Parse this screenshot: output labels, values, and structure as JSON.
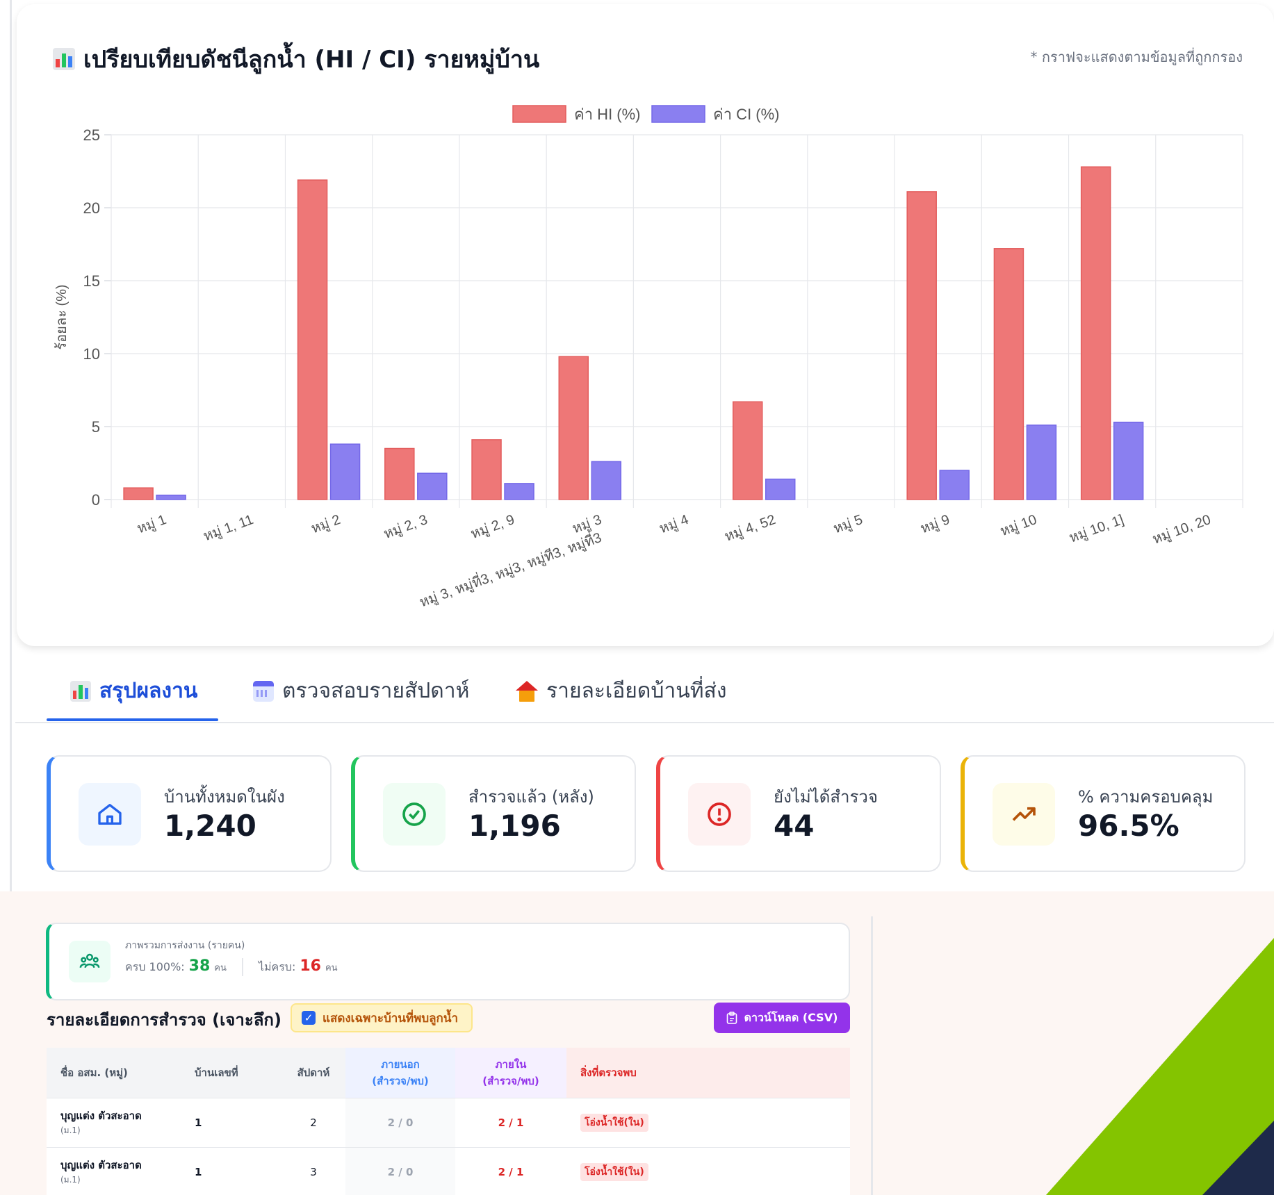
{
  "chart_card": {
    "title": "เปรียบเทียบดัชนีลูกน้ำ (HI / CI) รายหมู่บ้าน",
    "note": "* กราฟจะแสดงตามข้อมูลที่ถูกกรอง"
  },
  "chart_data": {
    "type": "bar",
    "categories": [
      "หมู่ 1",
      "หมู่ 1, 11",
      "หมู่ 2",
      "หมู่ 2, 3",
      "หมู่ 2, 9",
      [
        "หมู่ 3",
        "หมู่ 3, หมู่ที่3, หมู่3, หมู่ที3, หมู่ที่3"
      ],
      "หมู่ 4",
      "หมู่ 4, 52",
      "หมู่ 5",
      "หมู่ 9",
      "หมู่ 10",
      "หมู่ 10, 1]",
      "หมู่ 10, 20"
    ],
    "series": [
      {
        "name": "ค่า HI (%)",
        "color": "#ee7777",
        "values": [
          0.8,
          0,
          21.9,
          3.5,
          4.1,
          9.8,
          0,
          6.7,
          0,
          21.1,
          17.2,
          22.8,
          0,
          0
        ]
      },
      {
        "name": "ค่า CI (%)",
        "color": "#8a7ff0",
        "values": [
          0.3,
          0,
          3.8,
          1.8,
          1.1,
          2.6,
          0,
          1.4,
          0,
          2.0,
          5.1,
          5.3,
          0,
          0
        ]
      }
    ],
    "xlabel": "",
    "ylabel": "ร้อยละ (%)",
    "ylim": [
      0,
      25
    ],
    "yticks": [
      0,
      5,
      10,
      15,
      20,
      25
    ],
    "grid": true,
    "legend": "top-center"
  },
  "tabs": [
    {
      "label": "สรุปผลงาน",
      "active": true
    },
    {
      "label": "ตรวจสอบรายสัปดาห์",
      "active": false
    },
    {
      "label": "รายละเอียดบ้านที่ส่ง",
      "active": false
    }
  ],
  "stats": [
    {
      "label": "บ้านทั้งหมดในผัง",
      "value": "1,240",
      "color": "#3b82f6",
      "icon": "home-icon"
    },
    {
      "label": "สำรวจแล้ว (หลัง)",
      "value": "1,196",
      "color": "#22c55e",
      "icon": "check-circle-icon"
    },
    {
      "label": "ยังไม่ได้สำรวจ",
      "value": "44",
      "color": "#ef4444",
      "icon": "alert-circle-icon"
    },
    {
      "label": "% ความครอบคลุม",
      "value": "96.5%",
      "color": "#eab308",
      "icon": "trending-up-icon"
    }
  ],
  "summary": {
    "title": "ภาพรวมการส่งงาน (รายคน)",
    "complete_label": "ครบ 100%:",
    "complete_value": "38",
    "incomplete_label": "ไม่ครบ:",
    "incomplete_value": "16",
    "unit": "คน"
  },
  "detail": {
    "title": "รายละเอียดการสำรวจ (เจาะลึก)",
    "filter_label": "แสดงเฉพาะบ้านที่พบลูกน้ำ",
    "download_label": "ดาวน์โหลด (CSV)",
    "headers": {
      "name": "ชื่อ อสม. (หมู่)",
      "house": "บ้านเลขที่",
      "week": "สัปดาห์",
      "outside": [
        "ภายนอก",
        "(สำรวจ/พบ)"
      ],
      "inside": [
        "ภายใน",
        "(สำรวจ/พบ)"
      ],
      "found": "สิ่งที่ตรวจพบ"
    },
    "rows": [
      {
        "name": "บุญแต่ง ตัวสะอาด",
        "village": "(ม.1)",
        "house": "1",
        "week": "2",
        "outside": "2 / 0",
        "inside": "2 / 1",
        "found": "โอ่งน้ำใช้(ใน)"
      },
      {
        "name": "บุญแต่ง ตัวสะอาด",
        "village": "(ม.1)",
        "house": "1",
        "week": "3",
        "outside": "2 / 0",
        "inside": "2 / 1",
        "found": "โอ่งน้ำใช้(ใน)"
      }
    ]
  }
}
